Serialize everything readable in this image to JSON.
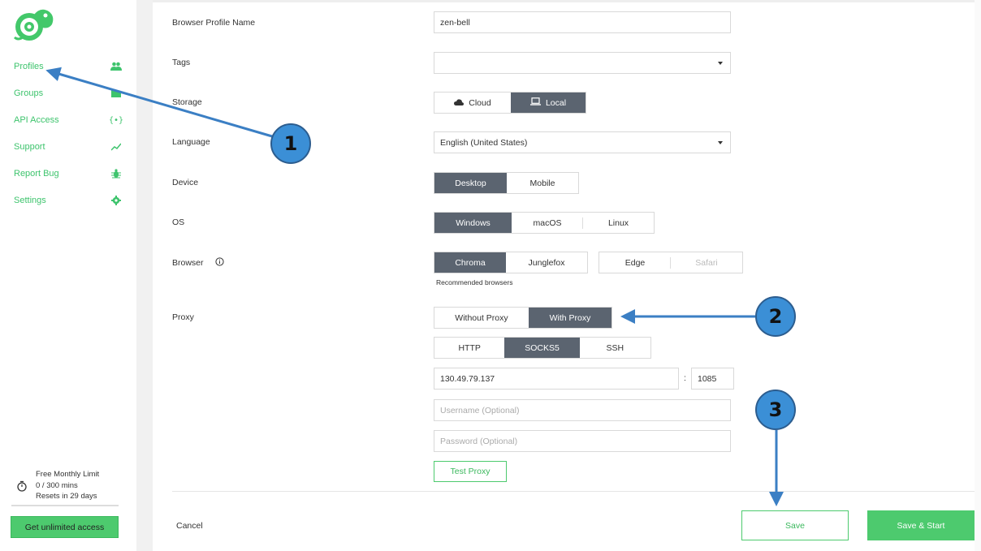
{
  "sidebar": {
    "logo_icon": "chameleon-logo-icon",
    "items": [
      {
        "label": "Profiles",
        "icon": "users-icon"
      },
      {
        "label": "Groups",
        "icon": "folder-icon"
      },
      {
        "label": "API Access",
        "icon": "braces-icon"
      },
      {
        "label": "Support",
        "icon": "trend-icon"
      },
      {
        "label": "Report Bug",
        "icon": "bug-icon"
      },
      {
        "label": "Settings",
        "icon": "gear-icon"
      }
    ],
    "limit": {
      "title": "Free Monthly Limit",
      "usage": "0 / 300 mins",
      "reset": "Resets in 29 days",
      "icon": "stopwatch-icon"
    },
    "upgrade_label": "Get unlimited access"
  },
  "form": {
    "profile_name": {
      "label": "Browser Profile Name",
      "value": "zen-bell"
    },
    "tags": {
      "label": "Tags",
      "value": ""
    },
    "storage": {
      "label": "Storage",
      "options": [
        "Cloud",
        "Local"
      ],
      "selected": "Local"
    },
    "language": {
      "label": "Language",
      "value": "English (United States)"
    },
    "device": {
      "label": "Device",
      "options": [
        "Desktop",
        "Mobile"
      ],
      "selected": "Desktop"
    },
    "os": {
      "label": "OS",
      "options": [
        "Windows",
        "macOS",
        "Linux"
      ],
      "selected": "Windows"
    },
    "browser": {
      "label": "Browser",
      "recommended": [
        "Chroma",
        "Junglefox"
      ],
      "other": [
        "Edge",
        "Safari"
      ],
      "selected": "Chroma",
      "note": "Recommended browsers"
    },
    "proxy": {
      "label": "Proxy",
      "mode_options": [
        "Without Proxy",
        "With Proxy"
      ],
      "mode_selected": "With Proxy",
      "type_options": [
        "HTTP",
        "SOCKS5",
        "SSH"
      ],
      "type_selected": "SOCKS5",
      "host": "130.49.79.137",
      "separator": ":",
      "port": "1085",
      "username_placeholder": "Username (Optional)",
      "password_placeholder": "Password (Optional)",
      "test_label": "Test Proxy"
    }
  },
  "footer": {
    "cancel_label": "Cancel",
    "save_label": "Save",
    "save_start_label": "Save & Start"
  },
  "annotations": {
    "markers": [
      "1",
      "2",
      "3"
    ],
    "color": "#3b8fd6"
  },
  "colors": {
    "accent": "#4dca6e",
    "active_segment": "#5b6470"
  }
}
